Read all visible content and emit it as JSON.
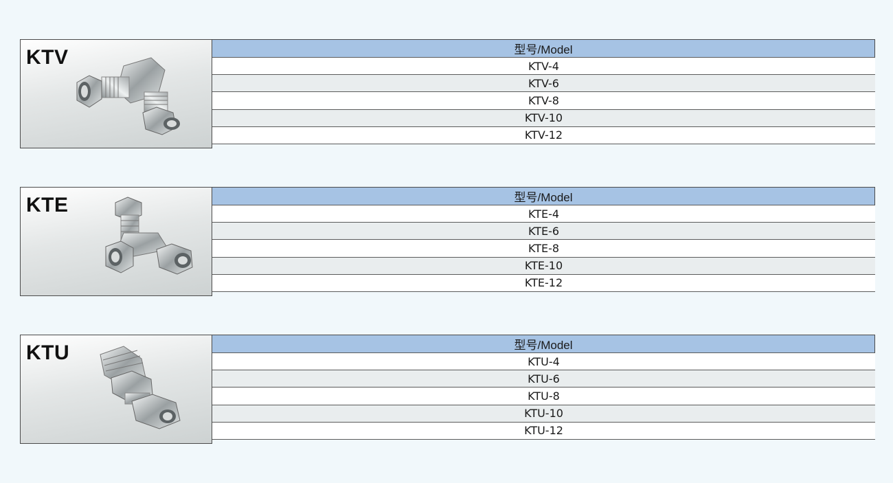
{
  "sections": [
    {
      "code": "KTV",
      "header": "型号/Model",
      "models": [
        "KTV-4",
        "KTV-6",
        "KTV-8",
        "KTV-10",
        "KTV-12"
      ]
    },
    {
      "code": "KTE",
      "header": "型号/Model",
      "models": [
        "KTE-4",
        "KTE-6",
        "KTE-8",
        "KTE-10",
        "KTE-12"
      ]
    },
    {
      "code": "KTU",
      "header": "型号/Model",
      "models": [
        "KTU-4",
        "KTU-6",
        "KTU-8",
        "KTU-10",
        "KTU-12"
      ]
    }
  ],
  "colors": {
    "page_background": "#f1f8fb",
    "header_background": "#a6c3e4",
    "row_alt_background": "#e9edee"
  }
}
